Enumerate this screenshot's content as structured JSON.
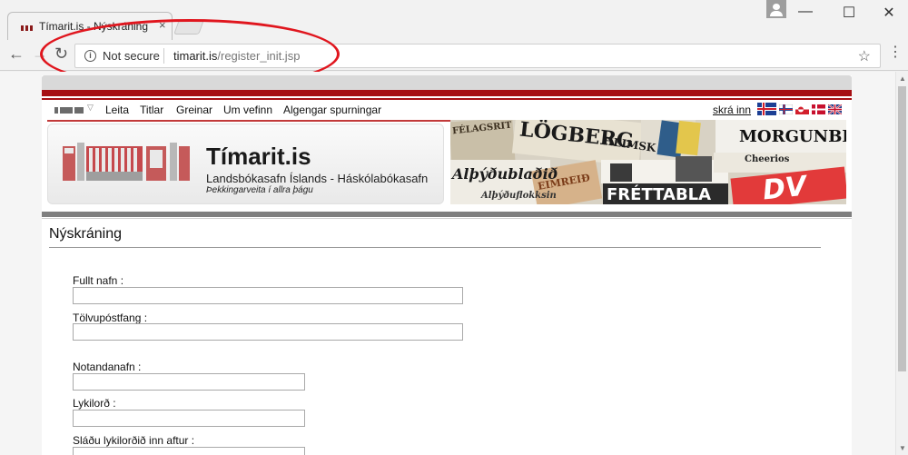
{
  "browser": {
    "tab_title": "Tímarit.is - Nýskráning",
    "tab_close": "×",
    "security_label": "Not secure",
    "url_domain": "timarit.is",
    "url_path": "/register_init.jsp",
    "controls": {
      "minimize": "—",
      "maximize": "☐",
      "close": "✕"
    },
    "nav": {
      "back": "←",
      "forward": "→",
      "reload": "↻",
      "bookmark": "☆",
      "menu": "⋮",
      "info": "i"
    }
  },
  "annotation": {
    "color": "#e0161e"
  },
  "site": {
    "nav": [
      "Leita",
      "Titlar",
      "Greinar",
      "Um vefinn",
      "Algengar spurningar"
    ],
    "login": "skrá inn",
    "languages": [
      "icelandic-flag",
      "faroese-flag",
      "greenlandic-flag",
      "danish-flag",
      "english-flag"
    ],
    "title": "Tímarit.is",
    "subtitle": "Landsbókasafn Íslands - Háskólabókasafn",
    "tagline": "Þekkingarveita í allra þágu",
    "accent_color": "#a60f13",
    "newspapers": [
      "FÉLAGSRIT",
      "LÖGBERG",
      "HEIMSK",
      "MORGUNBLA",
      "Alþýðublaðið",
      "EIMREIÐ",
      "Cheerios",
      "FRÉTTABLA",
      "DV",
      "Alþýðuflokksin"
    ]
  },
  "form": {
    "title": "Nýskráning",
    "fields": [
      {
        "label": "Fullt nafn :",
        "value": ""
      },
      {
        "label": "Tölvupóstfang :",
        "value": ""
      },
      {
        "label": "Notandanafn :",
        "value": ""
      },
      {
        "label": "Lykilorð :",
        "value": ""
      },
      {
        "label": "Sláðu lykilorðið inn aftur :",
        "value": ""
      }
    ]
  }
}
